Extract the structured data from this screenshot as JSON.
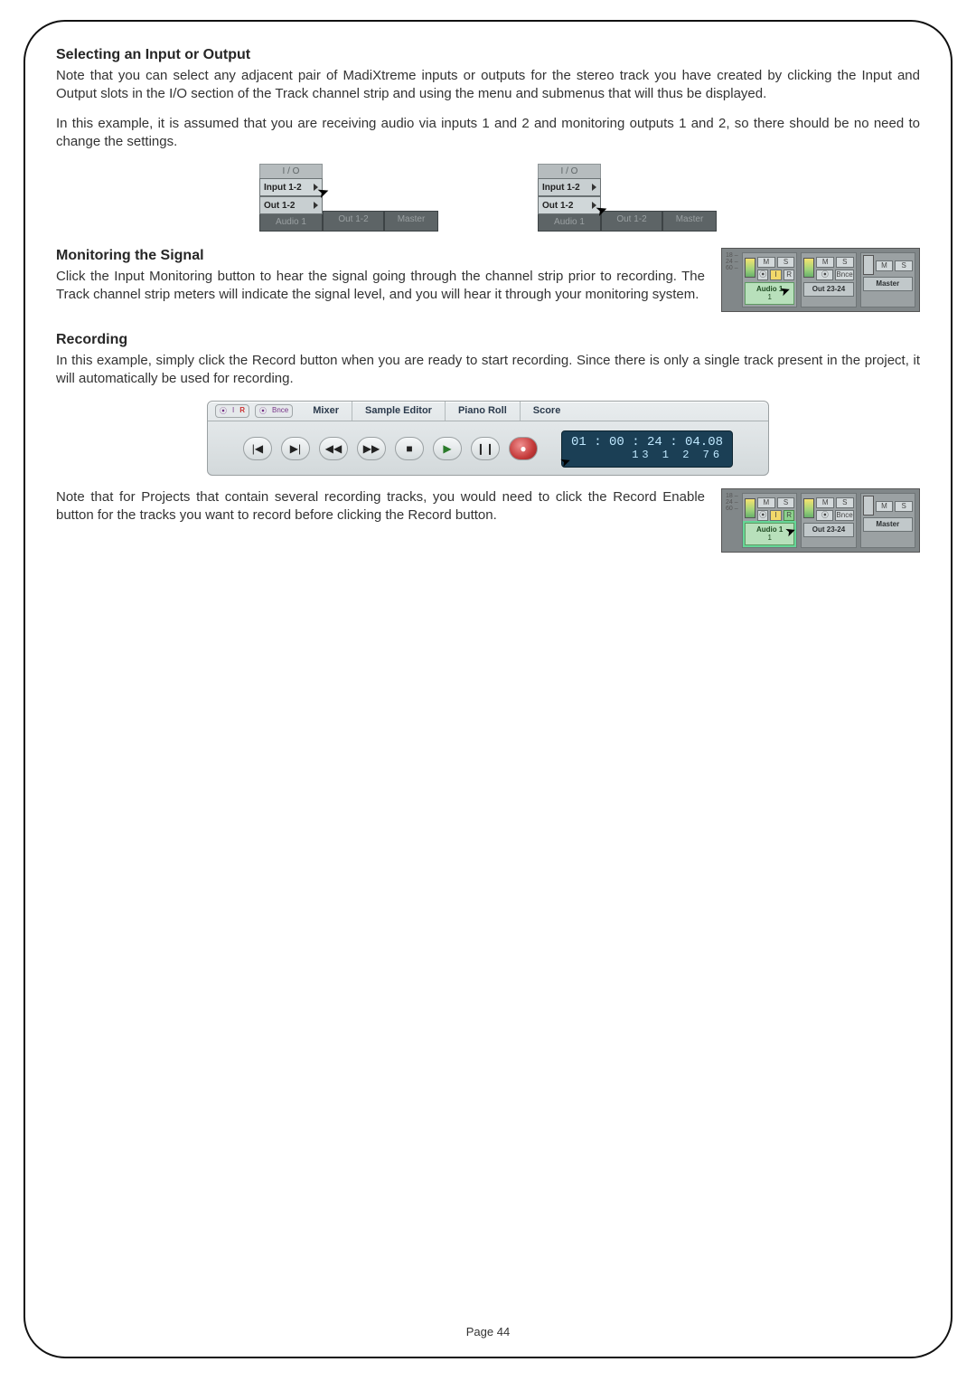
{
  "page_number_label": "Page",
  "page_number": "44",
  "s1": {
    "heading": "Selecting an Input or Output",
    "p1": "Note that you can select any adjacent pair of MadiXtreme inputs or outputs for the stereo track you have created by clicking the Input and Output slots in the I/O section of the Track channel strip and using the menu and submenus that will thus be displayed.",
    "p2": "In this example, it is assumed that you are receiving audio via inputs 1 and 2 and monitoring outputs 1 and 2, so there should be no need to change the settings."
  },
  "io_fig": {
    "header": "I / O",
    "input": "Input 1-2",
    "output": "Out 1-2",
    "labels": [
      "Audio 1",
      "Out 1-2",
      "Master"
    ]
  },
  "s2": {
    "heading": "Monitoring the Signal",
    "p1": "Click the Input Monitoring button to hear the signal going through the channel strip prior to recording. The Track channel strip meters will indicate the signal level, and you will hear it through your monitoring system."
  },
  "mon_thumb": {
    "scale": "18 –\n24 –\n60 –",
    "ms": [
      "M",
      "S"
    ],
    "record_disc": "⦿",
    "i_btn": "I",
    "r_btn": "R",
    "bnce": "Bnce",
    "names": [
      "Audio 1",
      "Out 23-24",
      "Master"
    ],
    "sub": "1"
  },
  "s3": {
    "heading": "Recording",
    "p1": "In this example, simply click the Record button when you are ready to start recording. Since there is only a single track present in the project, it will automatically be used for recording.",
    "p2": "Note that for Projects that contain several recording tracks, you would need to click the Record Enable button for the tracks you want to record before clicking the Record button."
  },
  "transport": {
    "pre1": [
      "⦿",
      "I",
      "R"
    ],
    "pre1_last_red": true,
    "pre2": [
      "⦿",
      "Bnce"
    ],
    "tabs": [
      "Mixer",
      "Sample Editor",
      "Piano Roll",
      "Score"
    ],
    "buttons": {
      "rtz": "|◀",
      "gend": "▶|",
      "rew": "◀◀",
      "ff": "▶▶",
      "stop": "■",
      "play": "▶",
      "pause": "❙❙",
      "rec": "●"
    },
    "tc_main": "01 : 00 : 24 : 04.08",
    "tc_sub": "13  1  2  76"
  }
}
